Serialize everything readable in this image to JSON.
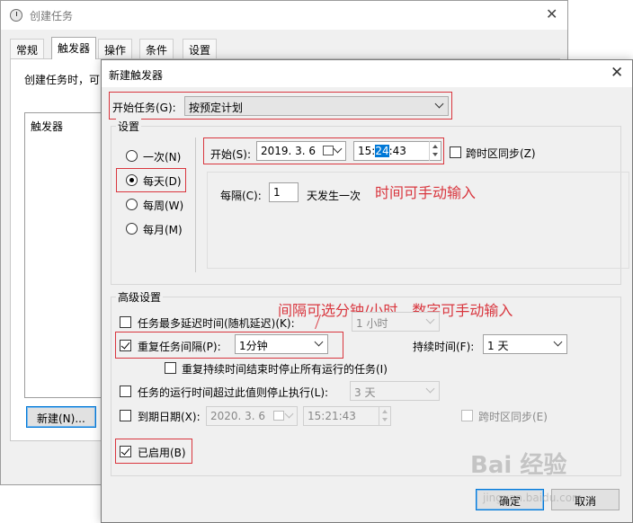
{
  "back_window": {
    "title": "创建任务",
    "tabs": [
      "常规",
      "触发器",
      "操作",
      "条件",
      "设置"
    ],
    "description": "创建任务时，可",
    "list_header": "触发器",
    "new_button": "新建(N)..."
  },
  "dialog": {
    "title": "新建触发器",
    "begin_task_label": "开始任务(G):",
    "begin_task_value": "按预定计划",
    "settings_group": "设置",
    "frequency_options": [
      "一次(N)",
      "每天(D)",
      "每周(W)",
      "每月(M)"
    ],
    "selected_frequency": "每天(D)",
    "start_label": "开始(S):",
    "start_date": "2019. 3. 6",
    "start_time_prefix": "15:",
    "start_time_selected": "24",
    "start_time_suffix": ":43",
    "sync_timezone_label": "跨时区同步(Z)",
    "recur_label": "每隔(C):",
    "recur_value": "1",
    "recur_unit": "天发生一次",
    "advanced_group": "高级设置",
    "delay_label": "任务最多延迟时间(随机延迟)(K):",
    "delay_value": "1 小时",
    "repeat_label": "重复任务间隔(P):",
    "repeat_value": "1分钟",
    "duration_label": "持续时间(F):",
    "duration_value": "1 天",
    "stop_all_label": "重复持续时间结束时停止所有运行的任务(I)",
    "stop_longer_label": "任务的运行时间超过此值则停止执行(L):",
    "stop_longer_value": "3 天",
    "expire_label": "到期日期(X):",
    "expire_date": "2020. 3. 6",
    "expire_time": "15:21:43",
    "expire_sync_label": "跨时区同步(E)",
    "enabled_label": "已启用(B)",
    "ok_button": "确定",
    "cancel_button": "取消"
  },
  "annotations": {
    "time_note": "时间可手动输入",
    "interval_note": "间隔可选分钟/小时，数字可手动输入"
  },
  "watermark": {
    "logo": "Bai 经验",
    "url": "jingyan.baidu.com"
  },
  "colors": {
    "annotation_red": "#d9363e",
    "selection_blue": "#0078d7"
  }
}
